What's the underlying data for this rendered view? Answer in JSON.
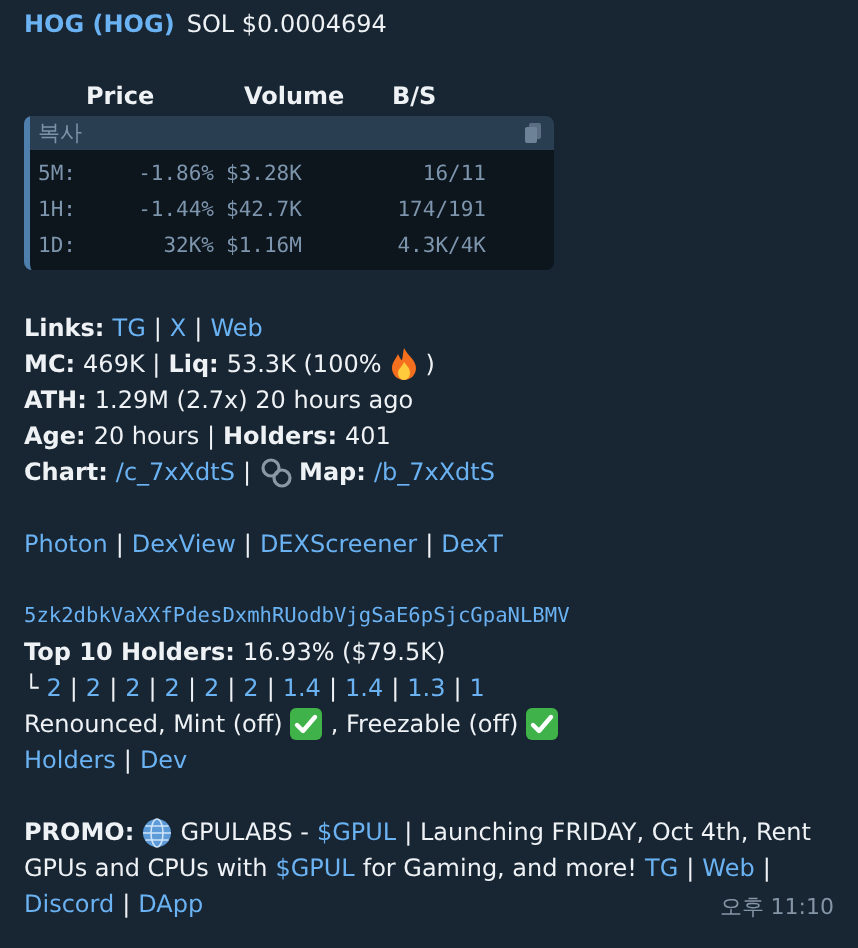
{
  "header": {
    "token": "HOG (HOG)",
    "price": "SOL $0.0004694"
  },
  "stats_table": {
    "columns": [
      "Price",
      "Volume",
      "B/S"
    ],
    "code_label": "복사",
    "rows": [
      {
        "period": "5M:",
        "price": "-1.86%",
        "volume": "$3.28K",
        "buy_sell": "16/11"
      },
      {
        "period": "1H:",
        "price": "-1.44%",
        "volume": "$42.7K",
        "buy_sell": "174/191"
      },
      {
        "period": "1D:",
        "price": "32K%",
        "volume": "$1.16M",
        "buy_sell": "4.3K/4K"
      }
    ]
  },
  "sections": [
    {
      "lines": [
        [
          {
            "kind": "bold",
            "text": "Links:"
          },
          {
            "kind": "link",
            "text": "TG"
          },
          {
            "kind": "text",
            "text": "|"
          },
          {
            "kind": "link",
            "text": "X"
          },
          {
            "kind": "text",
            "text": "|"
          },
          {
            "kind": "link",
            "text": "Web"
          }
        ],
        [
          {
            "kind": "bold",
            "text": "MC:"
          },
          {
            "kind": "text",
            "text": "469K |"
          },
          {
            "kind": "bold",
            "text": "Liq:"
          },
          {
            "kind": "text",
            "text": "53.3K (100%"
          },
          {
            "kind": "fire"
          },
          {
            "kind": "text",
            "text": ")"
          }
        ],
        [
          {
            "kind": "bold",
            "text": "ATH:"
          },
          {
            "kind": "text",
            "text": "1.29M (2.7x) 20 hours ago"
          }
        ],
        [
          {
            "kind": "bold",
            "text": "Age:"
          },
          {
            "kind": "text",
            "text": "20 hours |"
          },
          {
            "kind": "bold",
            "text": "Holders:"
          },
          {
            "kind": "text",
            "text": "401"
          }
        ],
        [
          {
            "kind": "bold",
            "text": "Chart:"
          },
          {
            "kind": "link",
            "text": "/c_7xXdtS"
          },
          {
            "kind": "text",
            "text": "|"
          },
          {
            "kind": "chain"
          },
          {
            "kind": "bold",
            "text": "Map:"
          },
          {
            "kind": "link",
            "text": "/b_7xXdtS"
          }
        ]
      ]
    },
    {
      "lines": [
        [
          {
            "kind": "link",
            "text": "Photon"
          },
          {
            "kind": "text",
            "text": "|"
          },
          {
            "kind": "link",
            "text": "DexView"
          },
          {
            "kind": "text",
            "text": "|"
          },
          {
            "kind": "link",
            "text": "DEXScreener"
          },
          {
            "kind": "text",
            "text": "|"
          },
          {
            "kind": "link",
            "text": "DexT"
          }
        ]
      ]
    },
    {
      "lines": [
        [
          {
            "kind": "code",
            "text": "5zk2dbkVaXXfPdesDxmhRUodbVjgSaE6pSjcGpaNLBMV"
          }
        ],
        [
          {
            "kind": "bold",
            "text": "Top 10 Holders:"
          },
          {
            "kind": "text",
            "text": "16.93% ($79.5K)"
          }
        ],
        [
          {
            "kind": "text",
            "text": "└"
          },
          {
            "kind": "link",
            "text": "2"
          },
          {
            "kind": "text",
            "text": "|"
          },
          {
            "kind": "link",
            "text": "2"
          },
          {
            "kind": "text",
            "text": "|"
          },
          {
            "kind": "link",
            "text": "2"
          },
          {
            "kind": "text",
            "text": "|"
          },
          {
            "kind": "link",
            "text": "2"
          },
          {
            "kind": "text",
            "text": "|"
          },
          {
            "kind": "link",
            "text": "2"
          },
          {
            "kind": "text",
            "text": "|"
          },
          {
            "kind": "link",
            "text": "2"
          },
          {
            "kind": "text",
            "text": "|"
          },
          {
            "kind": "link",
            "text": "1.4"
          },
          {
            "kind": "text",
            "text": "|"
          },
          {
            "kind": "link",
            "text": "1.4"
          },
          {
            "kind": "text",
            "text": "|"
          },
          {
            "kind": "link",
            "text": "1.3"
          },
          {
            "kind": "text",
            "text": "|"
          },
          {
            "kind": "link",
            "text": "1"
          }
        ],
        [
          {
            "kind": "text",
            "text": "Renounced, Mint (off)"
          },
          {
            "kind": "check"
          },
          {
            "kind": "text",
            "text": ", Freezable (off)"
          },
          {
            "kind": "check"
          }
        ],
        [
          {
            "kind": "link",
            "text": "Holders"
          },
          {
            "kind": "text",
            "text": "|"
          },
          {
            "kind": "link",
            "text": "Dev"
          }
        ]
      ]
    },
    {
      "lines": [
        [
          {
            "kind": "bold",
            "text": "PROMO:"
          },
          {
            "kind": "globe"
          },
          {
            "kind": "text",
            "text": "GPULABS -"
          },
          {
            "kind": "link",
            "text": "$GPUL"
          },
          {
            "kind": "text",
            "text": "| Launching FRIDAY, Oct 4th, Rent"
          }
        ],
        [
          {
            "kind": "text",
            "text": "GPUs and CPUs with"
          },
          {
            "kind": "link",
            "text": "$GPUL"
          },
          {
            "kind": "text",
            "text": "for Gaming, and more!"
          },
          {
            "kind": "link",
            "text": "TG"
          },
          {
            "kind": "text",
            "text": "|"
          },
          {
            "kind": "link",
            "text": "Web"
          },
          {
            "kind": "text",
            "text": "|"
          }
        ],
        [
          {
            "kind": "link",
            "text": "Discord"
          },
          {
            "kind": "text",
            "text": "|"
          },
          {
            "kind": "link",
            "text": "DApp"
          }
        ]
      ]
    }
  ],
  "timestamp": "오후 11:10"
}
